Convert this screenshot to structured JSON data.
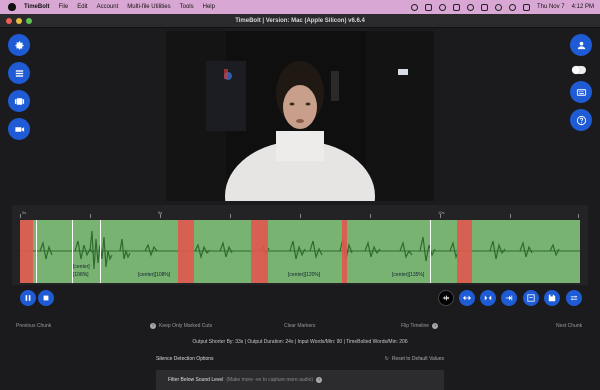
{
  "menubar": {
    "app": "TimeBolt",
    "items": [
      "File",
      "Edit",
      "Account",
      "Multi-file Utilities",
      "Tools",
      "Help"
    ],
    "date": "Thu Nov 7",
    "time": "4:12 PM"
  },
  "window": {
    "title": "TimeBolt | Version: Mac (Apple Silicon) v6.6.4"
  },
  "left_buttons": [
    "settings-icon",
    "list-icon",
    "film-icon",
    "camera-icon"
  ],
  "right_buttons": [
    "user-icon",
    "toggle",
    "keyboard-icon",
    "help-icon"
  ],
  "timeline": {
    "ruler_labels": [
      "0s",
      "5s",
      "10s"
    ],
    "labels": [
      "[center]",
      "[108%]",
      "[center][108%]",
      "[center][120%]",
      "[center][135%]"
    ]
  },
  "footer": {
    "previous_chunk": "Previous Chunk",
    "keep_only_marked": "Keep Only Marked Cuts",
    "clear_markers": "Clear Markers",
    "flip_timeline": "Flip Timeline",
    "next_chunk": "Next Chunk"
  },
  "stats": "Output Shorter By: 33s | Output Duration: 24s | Input Words/Min: 90 | TimeBolted Words/Min: 206",
  "silence": {
    "title": "Silence Detection Options",
    "reset": "Reset to Default Values"
  },
  "filter": {
    "label": "Filter Below Sound Level",
    "hint": "(Make more -ve to capture more audio)"
  },
  "colors": {
    "accent": "#1e5bd4",
    "waveform": "#79b371",
    "cut": "#e0574f",
    "menubar": "#d9a7d3"
  }
}
